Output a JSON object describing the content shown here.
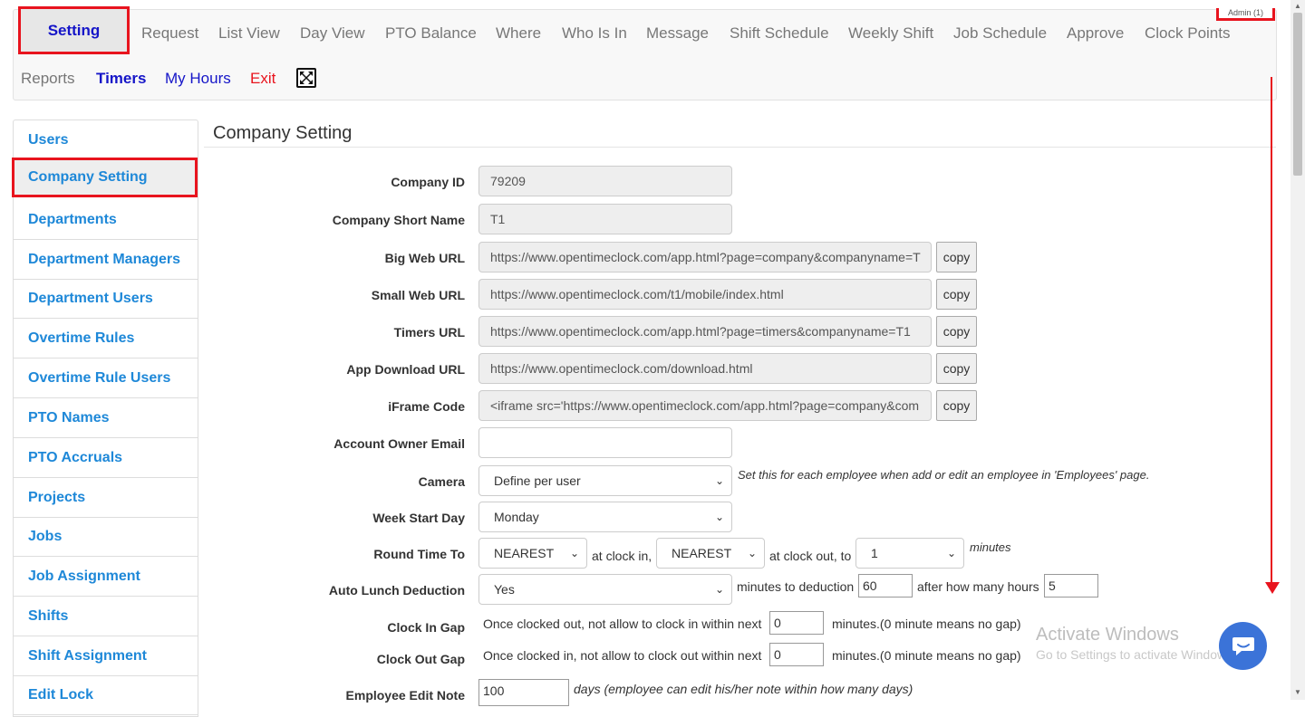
{
  "topnav": {
    "active": "Setting",
    "row1": [
      "Request",
      "List View",
      "Day View",
      "PTO Balance",
      "Where",
      "Who Is In",
      "Message",
      "Shift Schedule",
      "Weekly Shift",
      "Job Schedule",
      "Approve",
      "Clock Points"
    ],
    "reports": "Reports",
    "timers": "Timers",
    "my_hours": "My Hours",
    "exit": "Exit",
    "admin": "Admin (1)",
    "fullscreen_icon": "fullscreen-icon"
  },
  "sidebar": {
    "items": [
      "Users",
      "Company Setting",
      "Departments",
      "Department Managers",
      "Department Users",
      "Overtime Rules",
      "Overtime Rule Users",
      "PTO Names",
      "PTO Accruals",
      "Projects",
      "Jobs",
      "Job Assignment",
      "Shifts",
      "Shift Assignment",
      "Edit Lock"
    ],
    "active_index": 1
  },
  "main": {
    "title": "Company Setting",
    "copy_label": "copy",
    "fields": {
      "company_id": {
        "label": "Company ID",
        "value": "79209"
      },
      "short_name": {
        "label": "Company Short Name",
        "value": "T1"
      },
      "big_web_url": {
        "label": "Big Web URL",
        "value": "https://www.opentimeclock.com/app.html?page=company&companyname=T"
      },
      "small_web_url": {
        "label": "Small Web URL",
        "value": "https://www.opentimeclock.com/t1/mobile/index.html"
      },
      "timers_url": {
        "label": "Timers URL",
        "value": "https://www.opentimeclock.com/app.html?page=timers&companyname=T1"
      },
      "app_download_url": {
        "label": "App Download URL",
        "value": "https://www.opentimeclock.com/download.html"
      },
      "iframe_code": {
        "label": "iFrame Code",
        "value": "<iframe src='https://www.opentimeclock.com/app.html?page=company&com"
      },
      "owner_email": {
        "label": "Account Owner Email",
        "value": ""
      },
      "camera": {
        "label": "Camera",
        "value": "Define per user",
        "note": "Set this for each employee when add or edit an employee in 'Employees' page."
      },
      "week_start": {
        "label": "Week Start Day",
        "value": "Monday"
      },
      "round_time": {
        "label": "Round Time To",
        "clock_in": "NEAREST",
        "text_in": "at clock in,",
        "clock_out": "NEAREST",
        "text_out": "at clock out, to",
        "minutes_value": "1",
        "minutes_label": "minutes"
      },
      "auto_lunch": {
        "label": "Auto Lunch Deduction",
        "value": "Yes",
        "text1": "minutes to deduction",
        "minutes": "60",
        "text2": "after how many hours",
        "hours": "5"
      },
      "clock_in_gap": {
        "label": "Clock In Gap",
        "text": "Once clocked out, not allow to clock in within next",
        "value": "0",
        "suffix": "minutes.(0 minute means no gap)"
      },
      "clock_out_gap": {
        "label": "Clock Out Gap",
        "text": "Once clocked in, not allow to clock out within next",
        "value": "0",
        "suffix": "minutes.(0 minute means no gap)"
      },
      "edit_note": {
        "label": "Employee Edit Note",
        "value": "100",
        "suffix": "days (employee can edit his/her note within how many days)"
      }
    }
  },
  "watermark": {
    "line1": "Activate Windows",
    "line2": "Go to Settings to activate Windows."
  },
  "colors": {
    "accent_red": "#e8141e",
    "link_blue": "#1e88d8",
    "nav_blue": "#1515c8",
    "chat_blue": "#3b73d8"
  }
}
